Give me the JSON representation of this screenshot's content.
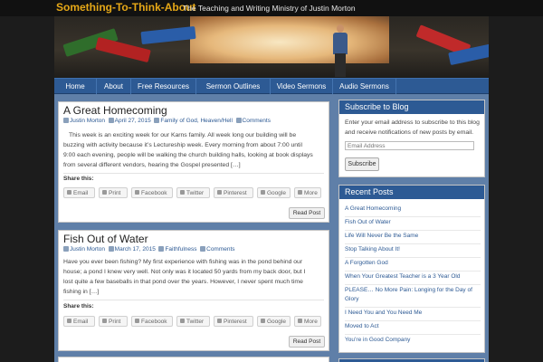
{
  "header": {
    "site_title": "Something-To-Think-About",
    "tagline": "The Teaching and Writing Ministry of Justin Morton"
  },
  "nav": {
    "items": [
      "Home",
      "About",
      "Free Resources",
      "Sermon Outlines",
      "Video Sermons",
      "Audio Sermons"
    ]
  },
  "posts": [
    {
      "title": "A Great Homecoming",
      "author": "Justin Morton",
      "date": "April 27, 2015",
      "categories": "Family of God, Heaven/Hell",
      "comments": "Comments",
      "excerpt_lines": [
        "This week is an exciting week for our Karns family. All week long our building will be",
        "buzzing with activity because it’s Lectureship week. Every morning from about 7:00 until",
        "9:00 each evening, people will be walking the church building halls, looking at book displays",
        "from several different vendors, hearing the Gospel presented […]"
      ],
      "share_label": "Share this:",
      "read_post": "Read Post"
    },
    {
      "title": "Fish Out of Water",
      "author": "Justin Morton",
      "date": "March 17, 2015",
      "categories": "Faithfulness",
      "comments": "Comments",
      "excerpt_lines": [
        "Have you ever been fishing? My first experience with fishing was in the pond behind our",
        "house; a pond I knew very well. Not only was it located 50 yards from my back door, but I",
        "lost quite a few baseballs in that pond over the years. However, I never spent much time",
        "fishing in […]"
      ],
      "share_label": "Share this:",
      "read_post": "Read Post"
    }
  ],
  "share_buttons": [
    "Email",
    "Print",
    "Facebook",
    "Twitter",
    "Pinterest",
    "Google",
    "More"
  ],
  "subscribe": {
    "title": "Subscribe to Blog",
    "text": "Enter your email address to subscribe to this blog and receive notifications of new posts by email.",
    "placeholder": "Email Address",
    "button": "Subscribe"
  },
  "recent_posts": {
    "title": "Recent Posts",
    "items": [
      "A Great Homecoming",
      "Fish Out of Water",
      "Life Will Never Be the Same",
      "Stop Talking About It!",
      "A Forgotten God",
      "When Your Greatest Teacher is a 3 Year Old",
      "PLEASE… No More Pain: Longing for the Day of Glory",
      "I Need You and You Need Me",
      "Moved to Act",
      "You’re in Good Company"
    ]
  },
  "colors": {
    "accent_blue": "#2d5a94",
    "title_gold": "#e6a817",
    "page_bg": "#1c1c1c",
    "content_bg": "#5f7fa8"
  }
}
